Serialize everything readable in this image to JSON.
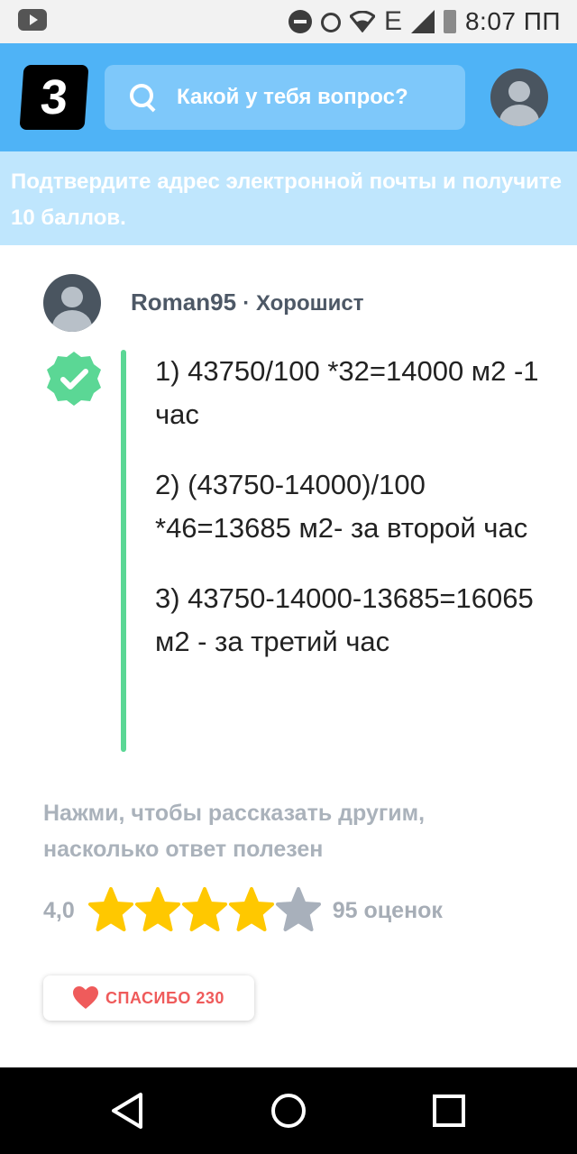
{
  "status_bar": {
    "time": "8:07 ПП",
    "network": "E"
  },
  "header": {
    "logo_text": "3",
    "search_placeholder": "Какой у тебя вопрос?"
  },
  "banner": {
    "text": "Подтвердите адрес электронной почты и получите 10 баллов."
  },
  "answer": {
    "author": "Roman95",
    "rank": "· Хорошист",
    "lines": [
      "1) 43750/100 *32=14000 м2 -1 час",
      "2) (43750-14000)/100 *46=13685 м2- за второй час",
      "3) 43750-14000-13685=16065 м2 - за третий час"
    ]
  },
  "rating": {
    "prompt": "Нажми, чтобы рассказать другим, насколько ответ полезен",
    "value": "4,0",
    "stars_filled": 4,
    "stars_total": 5,
    "count": "95 оценок",
    "star_color": "#ffc800",
    "star_empty_color": "#a8b0bb"
  },
  "thanks": {
    "label": "СПАСИБО 230",
    "color": "#ef5b5b"
  },
  "colors": {
    "header": "#4fb3f6",
    "banner": "#bfe6fd",
    "verified": "#5bd795"
  }
}
